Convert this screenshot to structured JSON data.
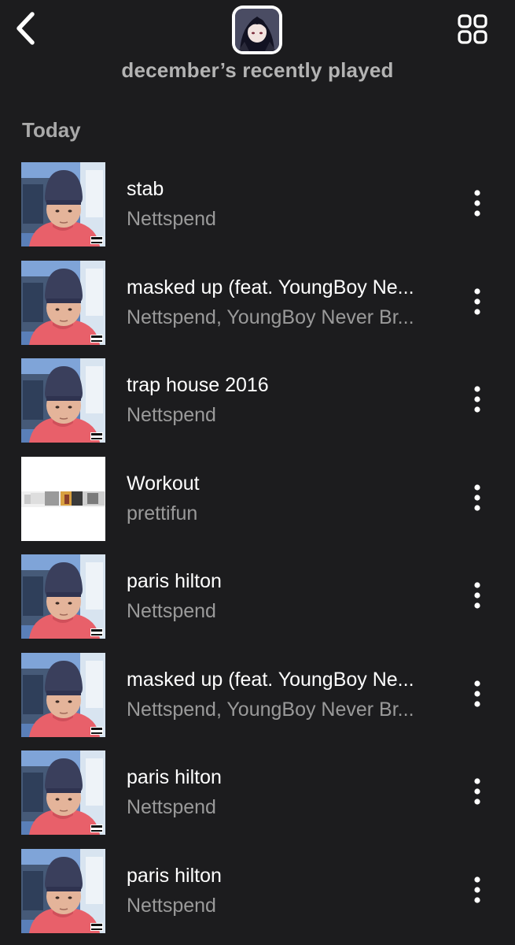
{
  "header": {
    "title": "december’s recently played",
    "back_icon": "chevron-left-icon",
    "grid_icon": "grid-icon"
  },
  "section": {
    "label": "Today"
  },
  "tracks": [
    {
      "title": "stab",
      "artist": "Nettspend",
      "cover": "portrait"
    },
    {
      "title": "masked up (feat. YoungBoy Ne...",
      "artist": "Nettspend, YoungBoy Never Br...",
      "cover": "portrait"
    },
    {
      "title": "trap house 2016",
      "artist": "Nettspend",
      "cover": "portrait"
    },
    {
      "title": "Workout",
      "artist": "prettifun",
      "cover": "white"
    },
    {
      "title": "paris hilton",
      "artist": "Nettspend",
      "cover": "portrait"
    },
    {
      "title": "masked up (feat. YoungBoy Ne...",
      "artist": "Nettspend, YoungBoy Never Br...",
      "cover": "portrait"
    },
    {
      "title": "paris hilton",
      "artist": "Nettspend",
      "cover": "portrait"
    },
    {
      "title": "paris hilton",
      "artist": "Nettspend",
      "cover": "portrait"
    }
  ],
  "colors": {
    "background": "#1c1c1e",
    "title_text": "#ffffff",
    "secondary_text": "#9a9a9a"
  }
}
